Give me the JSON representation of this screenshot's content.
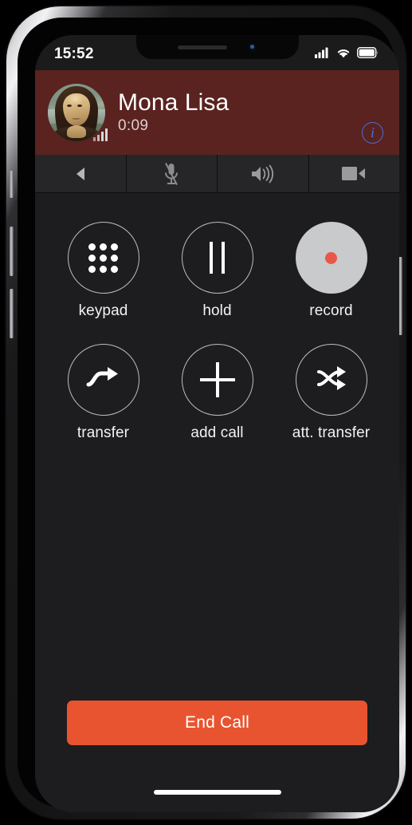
{
  "status_bar": {
    "time": "15:52",
    "cellular_icon": "signal-bars-icon",
    "wifi_icon": "wifi-icon",
    "battery_icon": "battery-icon"
  },
  "call_header": {
    "avatar_alt": "Mona Lisa",
    "avatar_icon": "contact-avatar",
    "signal_icon": "call-signal-bars-icon",
    "caller_name": "Mona Lisa",
    "call_duration": "0:09",
    "info_label": "i",
    "info_icon": "info-circle-icon",
    "background_color": "#5a2320"
  },
  "call_toolbar": {
    "items": [
      {
        "name": "back-button",
        "icon": "back-triangle-icon",
        "state": "inactive"
      },
      {
        "name": "mute-button",
        "icon": "microphone-muted-icon",
        "state": "muted"
      },
      {
        "name": "speaker-button",
        "icon": "speaker-waves-icon",
        "state": "inactive"
      },
      {
        "name": "video-button",
        "icon": "video-camera-icon",
        "state": "inactive"
      }
    ]
  },
  "call_actions": {
    "rows": [
      [
        {
          "label": "keypad",
          "icon": "keypad-dots-icon",
          "active": false
        },
        {
          "label": "hold",
          "icon": "pause-bars-icon",
          "active": false
        },
        {
          "label": "record",
          "icon": "record-dot-icon",
          "active": true
        }
      ],
      [
        {
          "label": "transfer",
          "icon": "curved-arrow-icon",
          "active": false
        },
        {
          "label": "add call",
          "icon": "plus-icon",
          "active": false
        },
        {
          "label": "att. transfer",
          "icon": "shuffle-arrows-icon",
          "active": false
        }
      ]
    ]
  },
  "end_call": {
    "label": "End Call",
    "color": "#e8542f"
  },
  "home_indicator": {
    "icon": "home-indicator-bar"
  }
}
